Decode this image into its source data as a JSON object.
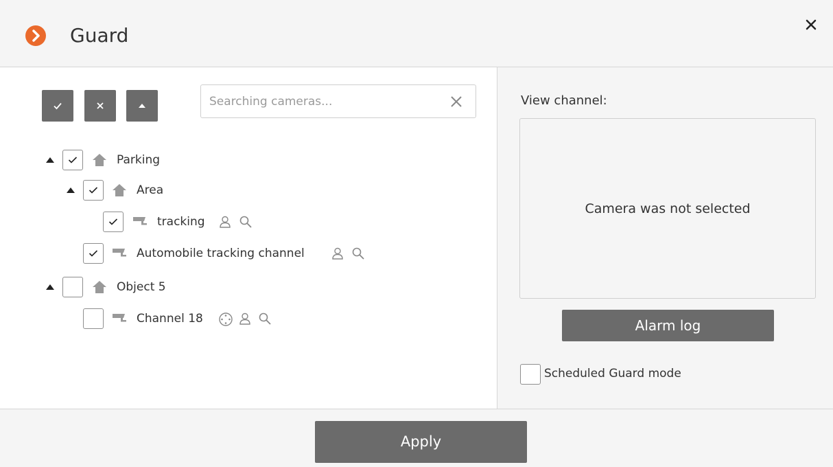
{
  "dialog": {
    "title": "Guard",
    "close_icon": "close-icon",
    "accent_color": "#ea6a2c"
  },
  "toolbar": {
    "buttons": [
      {
        "icon": "check-all-icon"
      },
      {
        "icon": "uncheck-all-icon"
      },
      {
        "icon": "collapse-all-icon"
      }
    ],
    "button_color": "#6b6b6b"
  },
  "search": {
    "placeholder": "Searching cameras...",
    "value": ""
  },
  "tree": [
    {
      "label": "Parking",
      "type": "object",
      "checked": true,
      "expanded": true,
      "level": 0
    },
    {
      "label": "Area",
      "type": "object",
      "checked": true,
      "expanded": true,
      "level": 1
    },
    {
      "label": "tracking",
      "type": "camera",
      "checked": true,
      "level": 2,
      "icons": [
        "person-icon",
        "search-icon"
      ]
    },
    {
      "label": "Automobile tracking channel",
      "type": "camera",
      "checked": true,
      "level": 1,
      "icons": [
        "person-icon",
        "search-icon"
      ]
    },
    {
      "label": "Object 5",
      "type": "object",
      "checked": false,
      "expanded": true,
      "level": 0
    },
    {
      "label": "Channel 18",
      "type": "camera",
      "checked": false,
      "level": 1,
      "icons": [
        "ptz-icon",
        "person-icon",
        "search-icon"
      ]
    }
  ],
  "view_channel": {
    "label": "View channel:",
    "empty_text": "Camera was not selected"
  },
  "alarm_log": {
    "label": "Alarm log"
  },
  "scheduled_guard": {
    "label": "Scheduled Guard mode",
    "checked": false
  },
  "footer": {
    "apply_label": "Apply"
  }
}
